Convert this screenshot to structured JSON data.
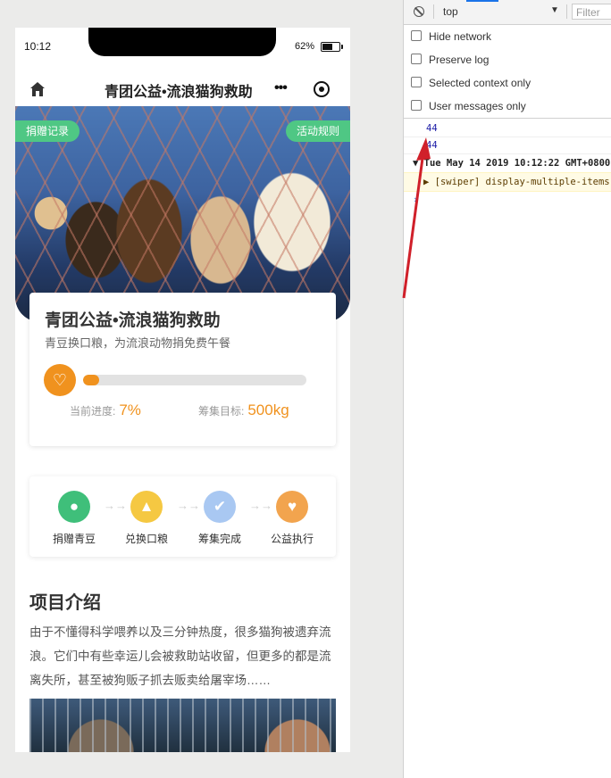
{
  "phone": {
    "status_time": "10:12",
    "battery": "62%",
    "nav_title": "青团公益•流浪猫狗救助",
    "hero_tag_left": "捐赠记录",
    "hero_tag_right": "活动规则",
    "card": {
      "title": "青团公益•流浪猫狗救助",
      "subtitle": "青豆换口粮，为流浪动物捐免费午餐",
      "progress_label": "当前进度:",
      "progress_value": "7%",
      "progress_fraction": 0.07,
      "goal_label": "筹集目标:",
      "goal_value": "500kg"
    },
    "steps": [
      {
        "label": "捐赠青豆",
        "icon": "bean-icon",
        "glyph": "●",
        "color": "#3fbf7a"
      },
      {
        "label": "兑换口粮",
        "icon": "thumbs-up-icon",
        "glyph": "👍",
        "color": "#f5c842"
      },
      {
        "label": "筹集完成",
        "icon": "check-icon",
        "glyph": "✔",
        "color": "#a9c8f2"
      },
      {
        "label": "公益执行",
        "icon": "heart-icon",
        "glyph": "♥",
        "color": "#f2a44e"
      }
    ],
    "intro_title": "项目介绍",
    "intro_text": "由于不懂得科学喂养以及三分钟热度，很多猫狗被遗弃流浪。它们中有些幸运儿会被救助站收留，但更多的都是流离失所，甚至被狗贩子抓去贩卖给屠宰场……"
  },
  "devtools": {
    "context": "top",
    "filter_placeholder": "Filter",
    "options": [
      "Hide network",
      "Preserve log",
      "Selected context only",
      "User messages only"
    ],
    "log_1": "44",
    "log_2": "44",
    "log_group": "▼ Tue May 14 2019 10:12:22 GMT+0800",
    "log_warn": "▶ [swiper] display-multiple-items",
    "prompt": "›"
  },
  "colors": {
    "accent_orange": "#f0921e",
    "tag_green": "#4fc784",
    "annotation_red": "#d0202a"
  }
}
